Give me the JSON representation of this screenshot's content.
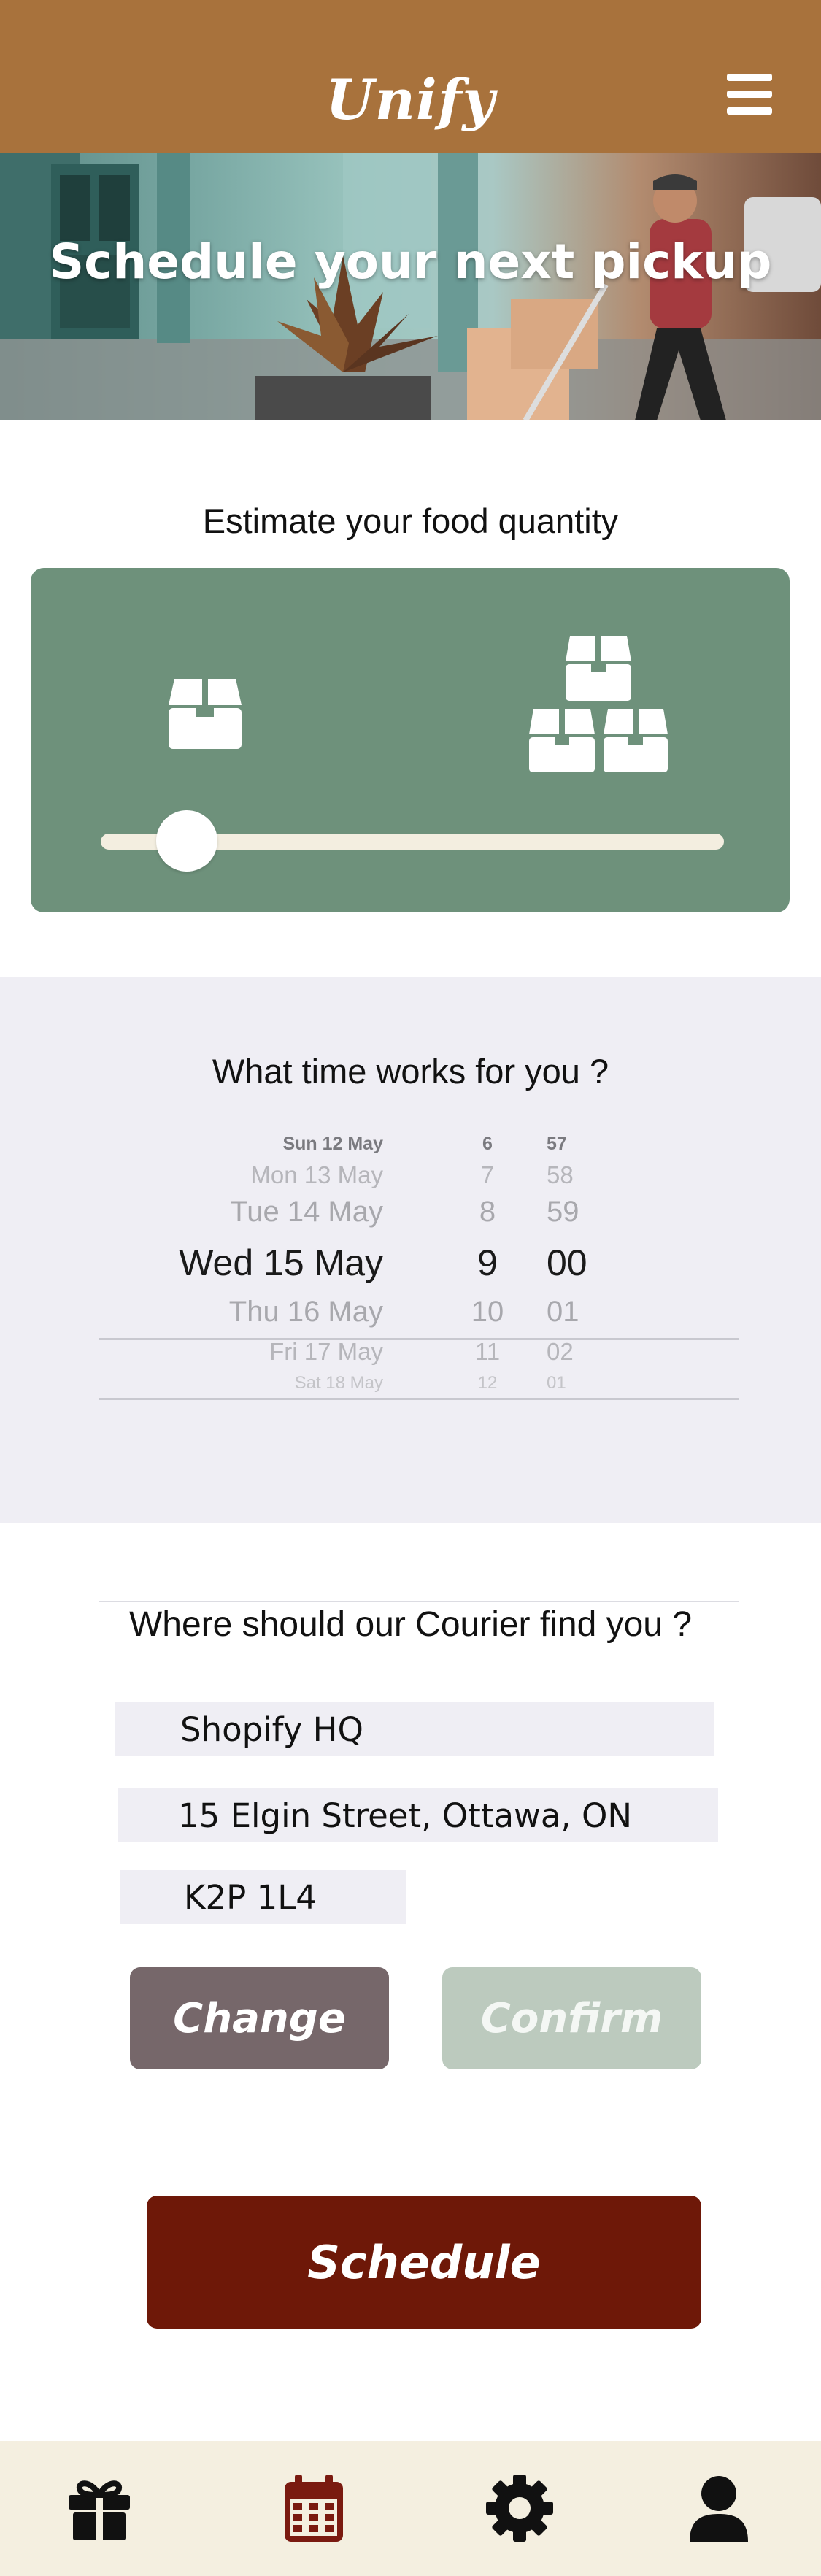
{
  "app": {
    "title": "Unify"
  },
  "hero": {
    "title": "Schedule your next pickup"
  },
  "quantity": {
    "label": "Estimate your food quantity",
    "level": 0.07,
    "min_icon": "single-box-icon",
    "max_icon": "stacked-boxes-icon"
  },
  "time": {
    "title": "What time works for you ?",
    "dates": [
      "Sun 12 May",
      "Mon 13 May",
      "Tue 14 May",
      "Wed 15 May",
      "Thu 16 May",
      "Fri 17 May",
      "Sat 18 May"
    ],
    "hours": [
      "6",
      "7",
      "8",
      "9",
      "10",
      "11",
      "12"
    ],
    "minutes": [
      "57",
      "58",
      "59",
      "00",
      "01",
      "02",
      "01"
    ],
    "selected": {
      "date": "Wed 15 May",
      "hour": "9",
      "minute": "00"
    }
  },
  "address": {
    "title": "Where should our Courier find you ?",
    "name": "Shopify HQ",
    "street": "15 Elgin Street, Ottawa, ON",
    "postal": "K2P 1L4"
  },
  "buttons": {
    "change": "Change",
    "confirm": "Confirm",
    "schedule": "Schedule"
  },
  "nav": {
    "items": [
      {
        "icon": "gift-icon"
      },
      {
        "icon": "calendar-icon"
      },
      {
        "icon": "gear-icon"
      },
      {
        "icon": "user-icon"
      }
    ]
  },
  "colors": {
    "header": "#a8723c",
    "card": "#6e917b",
    "change": "#76676a",
    "confirm": "#bccabe",
    "schedule": "#6e1808",
    "nav_bg": "#f4efe0",
    "calendar_active": "#7a1a10"
  }
}
